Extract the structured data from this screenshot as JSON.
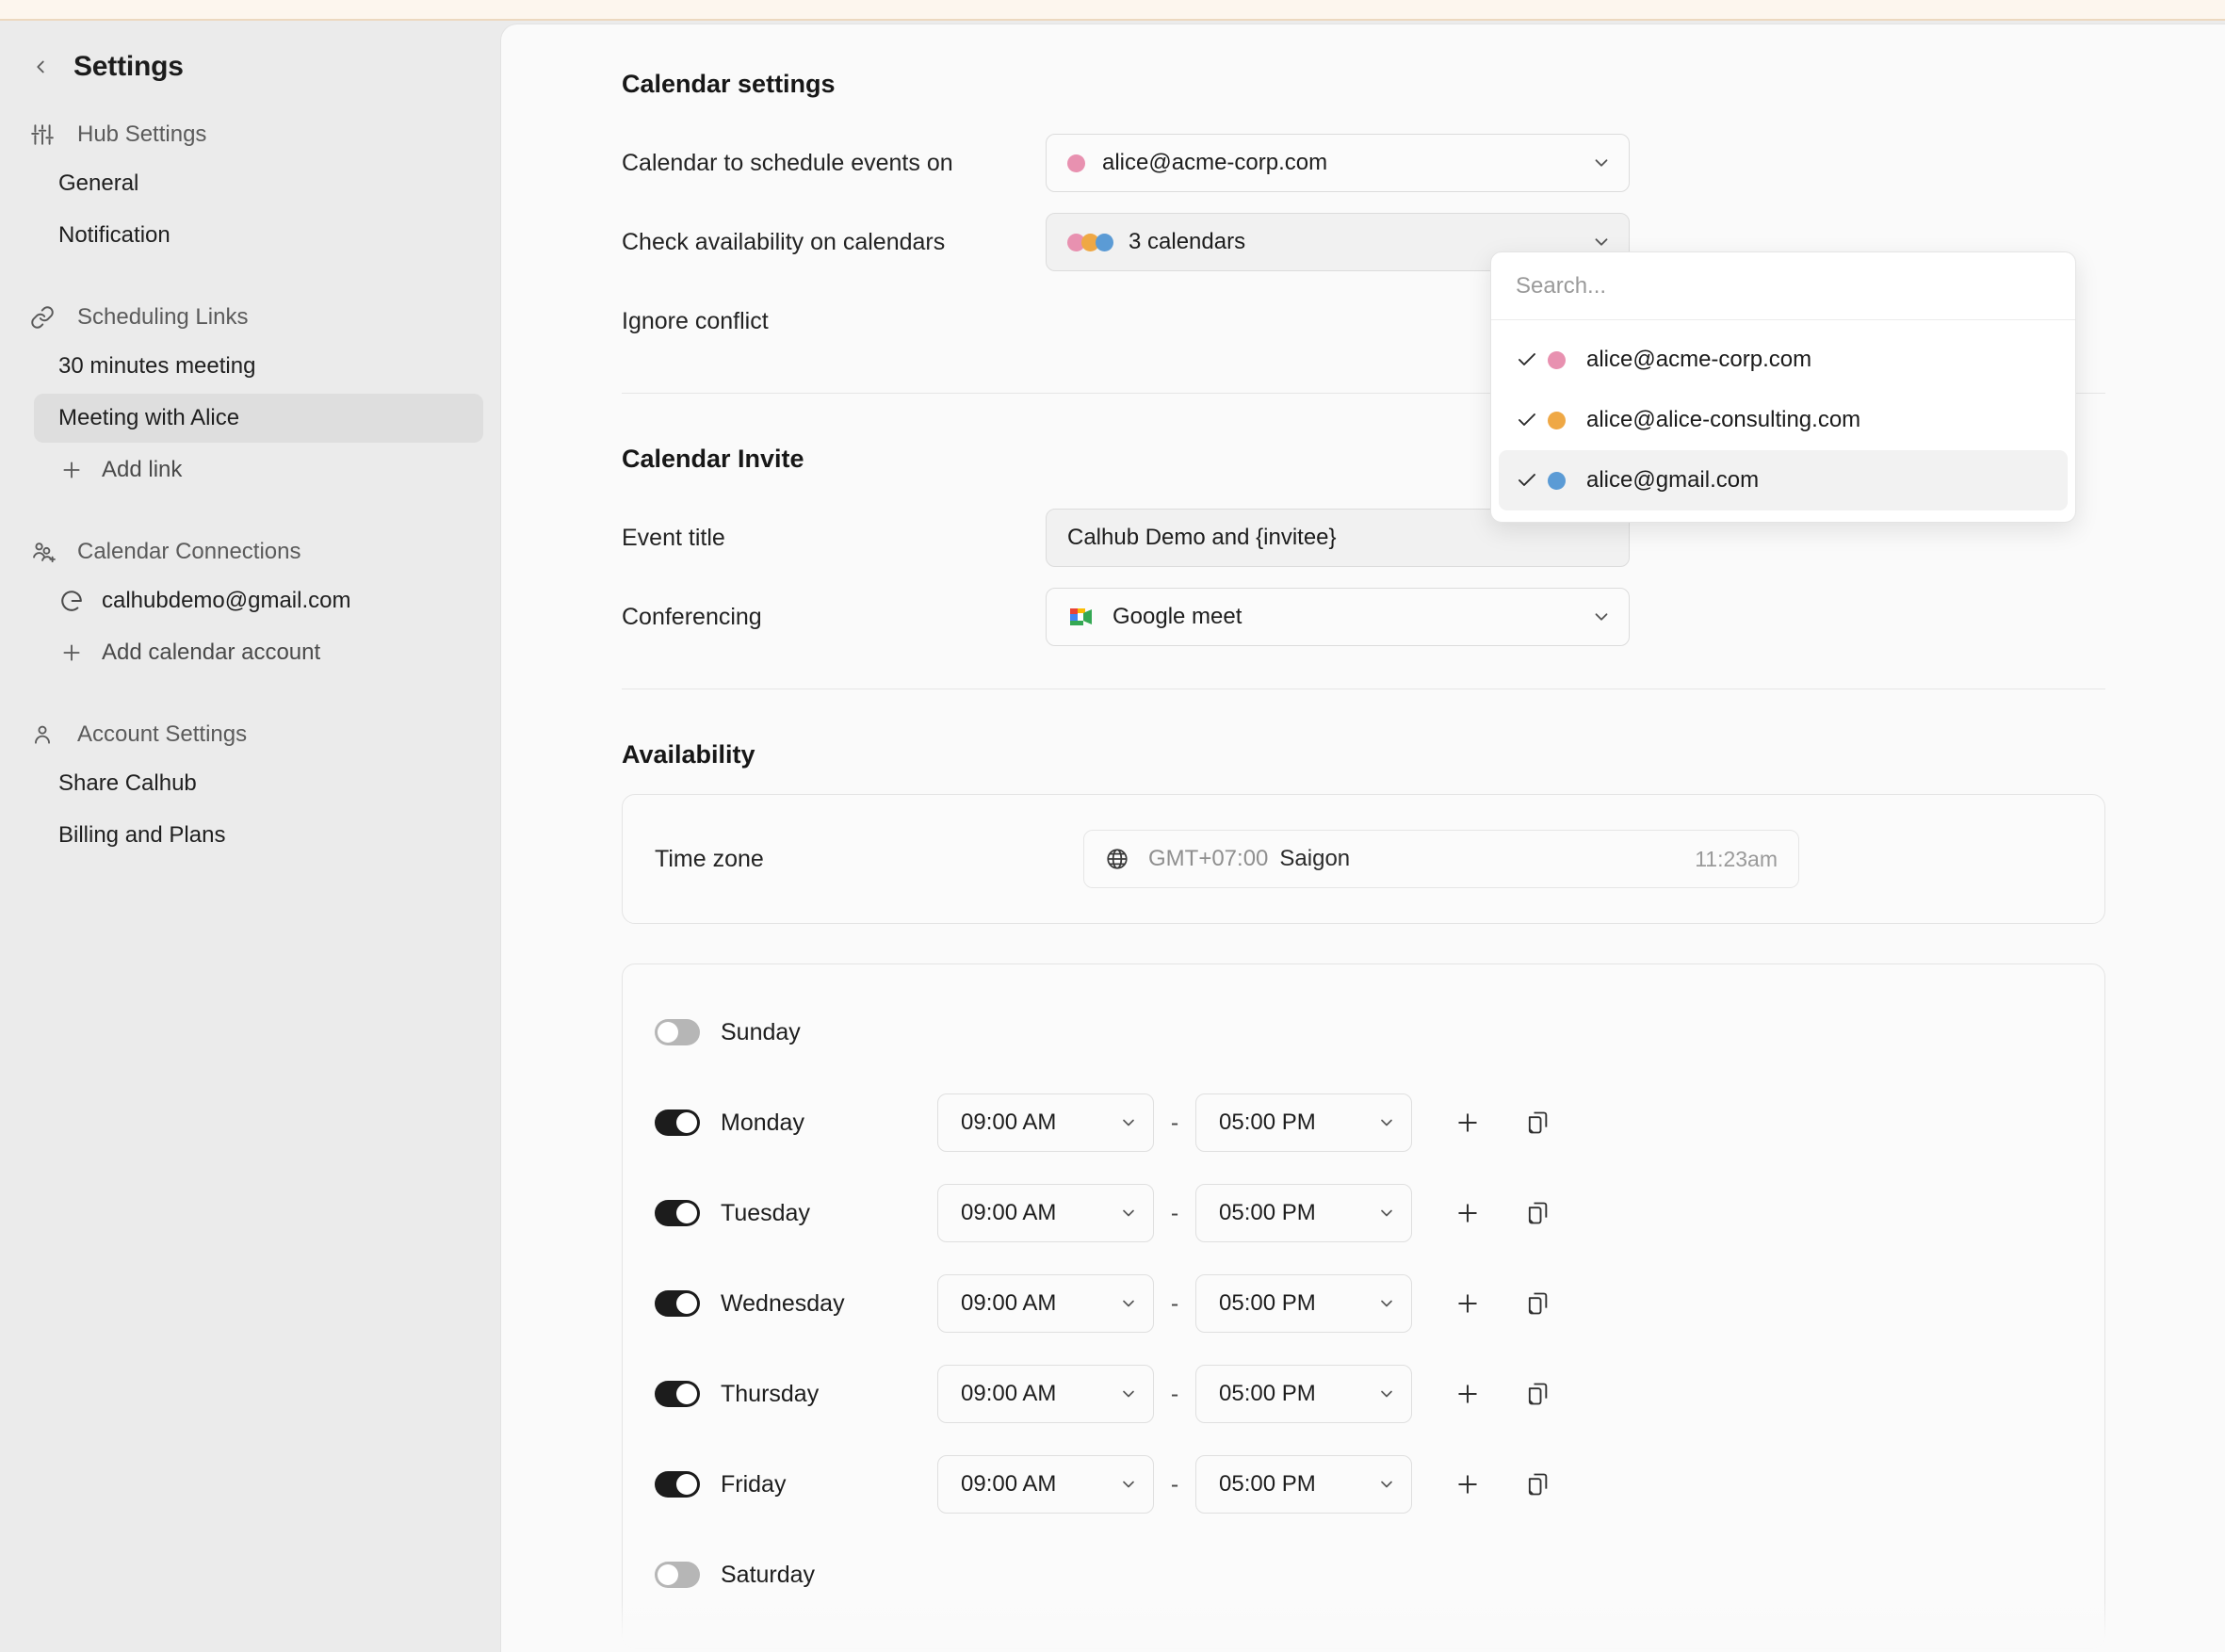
{
  "colors": {
    "accent_pink": "#e891b0",
    "accent_orange": "#efa845",
    "accent_blue": "#5b9bd5",
    "sidebar_bg": "#ebebeb",
    "panel_bg": "#fafafa",
    "active_item_bg": "#dedede",
    "banner_bg": "#fdf6ee"
  },
  "sidebar": {
    "title": "Settings",
    "back_icon": "chevron-left-icon",
    "groups": [
      {
        "icon": "sliders-icon",
        "label": "Hub Settings",
        "items": [
          {
            "label": "General",
            "active": false,
            "icon": null
          },
          {
            "label": "Notification",
            "active": false,
            "icon": null
          }
        ]
      },
      {
        "icon": "link-icon",
        "label": "Scheduling Links",
        "items": [
          {
            "label": "30 minutes meeting",
            "active": false,
            "icon": null
          },
          {
            "label": "Meeting with Alice",
            "active": true,
            "icon": null
          },
          {
            "label": "Add link",
            "active": false,
            "icon": "plus-icon"
          }
        ]
      },
      {
        "icon": "users-plus-icon",
        "label": "Calendar Connections",
        "items": [
          {
            "label": "calhubdemo@gmail.com",
            "active": false,
            "icon": "google-icon"
          },
          {
            "label": "Add calendar account",
            "active": false,
            "icon": "plus-icon"
          }
        ]
      },
      {
        "icon": "user-icon",
        "label": "Account Settings",
        "items": [
          {
            "label": "Share Calhub",
            "active": false,
            "icon": null
          },
          {
            "label": "Billing and Plans",
            "active": false,
            "icon": null
          }
        ]
      }
    ]
  },
  "main": {
    "calendar_settings": {
      "title": "Calendar settings",
      "schedule_on": {
        "label": "Calendar to schedule events on",
        "value": "alice@acme-corp.com",
        "dot_color": "#e891b0"
      },
      "check_availability": {
        "label": "Check availability on calendars",
        "value": "3 calendars",
        "dot_colors": [
          "#e891b0",
          "#efa845",
          "#5b9bd5"
        ]
      },
      "ignore_conflict": {
        "label": "Ignore conflict"
      }
    },
    "calendar_dropdown": {
      "search_placeholder": "Search...",
      "options": [
        {
          "label": "alice@acme-corp.com",
          "dot_color": "#e891b0",
          "checked": true,
          "highlighted": false
        },
        {
          "label": "alice@alice-consulting.com",
          "dot_color": "#efa845",
          "checked": true,
          "highlighted": false
        },
        {
          "label": "alice@gmail.com",
          "dot_color": "#5b9bd5",
          "checked": true,
          "highlighted": true
        }
      ]
    },
    "calendar_invite": {
      "title": "Calendar Invite",
      "event_title": {
        "label": "Event title",
        "value": "Calhub Demo and {invitee}"
      },
      "conferencing": {
        "label": "Conferencing",
        "value": "Google meet",
        "icon": "google-meet-icon"
      }
    },
    "availability": {
      "title": "Availability",
      "time_zone": {
        "label": "Time zone",
        "icon": "globe-icon",
        "offset": "GMT+07:00",
        "city": "Saigon",
        "current_time": "11:23am"
      },
      "days": [
        {
          "name": "Sunday",
          "enabled": false,
          "start": "",
          "end": "",
          "has_times": false
        },
        {
          "name": "Monday",
          "enabled": true,
          "start": "09:00 AM",
          "end": "05:00 PM",
          "has_times": true
        },
        {
          "name": "Tuesday",
          "enabled": true,
          "start": "09:00 AM",
          "end": "05:00 PM",
          "has_times": true
        },
        {
          "name": "Wednesday",
          "enabled": true,
          "start": "09:00 AM",
          "end": "05:00 PM",
          "has_times": true
        },
        {
          "name": "Thursday",
          "enabled": true,
          "start": "09:00 AM",
          "end": "05:00 PM",
          "has_times": true
        },
        {
          "name": "Friday",
          "enabled": true,
          "start": "09:00 AM",
          "end": "05:00 PM",
          "has_times": true
        },
        {
          "name": "Saturday",
          "enabled": false,
          "start": "",
          "end": "",
          "has_times": false
        }
      ],
      "time_separator": "-",
      "row_actions": {
        "add_icon": "plus-icon",
        "duplicate_icon": "copy-icon"
      }
    }
  }
}
